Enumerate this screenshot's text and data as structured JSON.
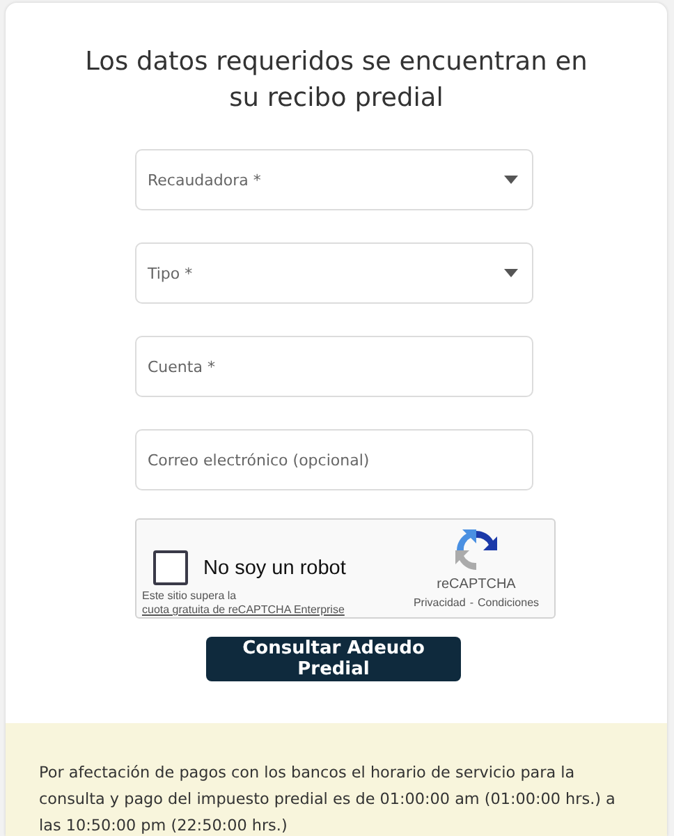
{
  "title": "Los datos requeridos se encuentran en su recibo predial",
  "fields": [
    {
      "kind": "select",
      "placeholder": "Recaudadora *"
    },
    {
      "kind": "select",
      "placeholder": "Tipo *"
    },
    {
      "kind": "input",
      "placeholder": "Cuenta *"
    },
    {
      "kind": "input",
      "placeholder": "Correo electrónico (opcional)"
    }
  ],
  "captcha": {
    "label": "No soy un robot",
    "checked": false,
    "note": "Este sitio supera la",
    "note_link": "cuota gratuita de reCAPTCHA Enterprise",
    "brand": "reCAPTCHA",
    "privacy": "Privacidad",
    "separator": "-",
    "terms": "Condiciones"
  },
  "submit": "Consultar Adeudo Predial",
  "notice": "Por afectación de pagos con los bancos el horario de servicio para la consulta y pago del impuesto predial es de 01:00:00 am (01:00:00 hrs.) a las 10:50:00 pm (22:50:00 hrs.)"
}
